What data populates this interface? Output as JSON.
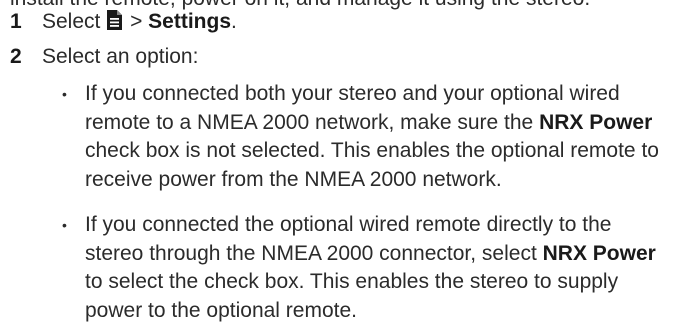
{
  "clipped_line": "install the remote, power on it, and manage it using the stereo.",
  "steps": [
    {
      "number": "1",
      "prefix": "Select",
      "icon": "menu-icon",
      "separator": ">",
      "target": "Settings",
      "suffix": "."
    },
    {
      "number": "2",
      "text": "Select an option:"
    }
  ],
  "bullets": [
    {
      "marker": "•",
      "before": "If you connected both your stereo and your optional wired remote to a NMEA 2000 network, make sure the",
      "bold": "NRX Power",
      "after": "check box is not selected. This enables the optional remote to receive power from the NMEA 2000 network."
    },
    {
      "marker": "•",
      "before": "If you connected the optional wired remote directly to the stereo through the NMEA 2000 connector, select",
      "bold": "NRX Power",
      "after": "to select the check box. This enables the stereo to supply power to the optional remote."
    }
  ]
}
